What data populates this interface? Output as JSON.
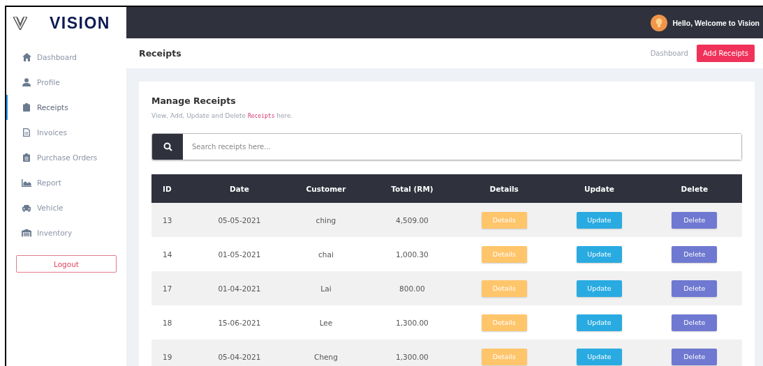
{
  "brand": {
    "name": "VISION"
  },
  "topbar": {
    "greeting": "Hello, Welcome to Vision"
  },
  "sidebar": {
    "items": [
      {
        "label": "Dashboard",
        "selected": false
      },
      {
        "label": "Profile",
        "selected": false
      },
      {
        "label": "Receipts",
        "selected": true
      },
      {
        "label": "Invoices",
        "selected": false
      },
      {
        "label": "Purchase Orders",
        "selected": false
      },
      {
        "label": "Report",
        "selected": false
      },
      {
        "label": "Vehicle",
        "selected": false
      },
      {
        "label": "Inventory",
        "selected": false
      }
    ],
    "logout": "Logout"
  },
  "page_header": {
    "title": "Receipts",
    "breadcrumb": "Dashboard",
    "action": "Add Receipts"
  },
  "card": {
    "title": "Manage Receipts",
    "subtitle_before": "View, Add, Update and Delete",
    "subtitle_code": "Receipts",
    "subtitle_after": "here.",
    "search": {
      "placeholder": "Search receipts here..."
    }
  },
  "table": {
    "columns": [
      "ID",
      "Date",
      "Customer",
      "Total (RM)",
      "Details",
      "Update",
      "Delete"
    ],
    "rows": [
      {
        "id": "13",
        "date": "05-05-2021",
        "customer": "ching",
        "total": "4,509.00",
        "details": "Details",
        "update": "Update",
        "delete": "Delete"
      },
      {
        "id": "14",
        "date": "01-05-2021",
        "customer": "chai",
        "total": "1,000.30",
        "details": "Details",
        "update": "Update",
        "delete": "Delete"
      },
      {
        "id": "17",
        "date": "01-04-2021",
        "customer": "Lai",
        "total": "800.00",
        "details": "Details",
        "update": "Update",
        "delete": "Delete"
      },
      {
        "id": "18",
        "date": "15-06-2021",
        "customer": "Lee",
        "total": "1,300.00",
        "details": "Details",
        "update": "Update",
        "delete": "Delete"
      },
      {
        "id": "19",
        "date": "05-04-2021",
        "customer": "Cheng",
        "total": "1,300.00",
        "details": "Details",
        "update": "Update",
        "delete": "Delete"
      }
    ]
  }
}
